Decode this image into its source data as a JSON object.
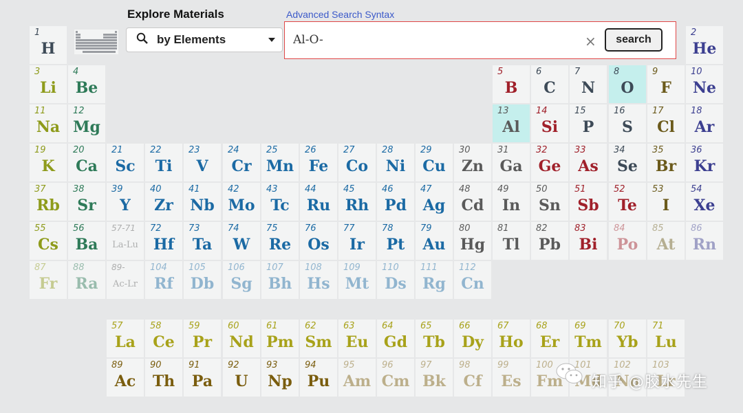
{
  "header": {
    "title": "Explore Materials",
    "advanced_link": "Advanced Search Syntax"
  },
  "search": {
    "mode_label": "by Elements",
    "value": "Al-O-",
    "clear_glyph": "×",
    "button_label": "search"
  },
  "watermark": {
    "text": "知乎 @胶水先生"
  },
  "elements": [
    {
      "n": "1",
      "s": "H",
      "row": 0,
      "col": 0,
      "c": "nonmetal"
    },
    {
      "n": "2",
      "s": "He",
      "row": 0,
      "col": 17,
      "c": "noble"
    },
    {
      "n": "3",
      "s": "Li",
      "row": 1,
      "col": 0,
      "c": "alkali"
    },
    {
      "n": "4",
      "s": "Be",
      "row": 1,
      "col": 1,
      "c": "alkaline"
    },
    {
      "n": "5",
      "s": "B",
      "row": 1,
      "col": 12,
      "c": "red"
    },
    {
      "n": "6",
      "s": "C",
      "row": 1,
      "col": 13,
      "c": "nonmetal"
    },
    {
      "n": "7",
      "s": "N",
      "row": 1,
      "col": 14,
      "c": "nonmetal"
    },
    {
      "n": "8",
      "s": "O",
      "row": 1,
      "col": 15,
      "c": "nonmetal",
      "hl": true
    },
    {
      "n": "9",
      "s": "F",
      "row": 1,
      "col": 16,
      "c": "halogen"
    },
    {
      "n": "10",
      "s": "Ne",
      "row": 1,
      "col": 17,
      "c": "noble"
    },
    {
      "n": "11",
      "s": "Na",
      "row": 2,
      "col": 0,
      "c": "alkali"
    },
    {
      "n": "12",
      "s": "Mg",
      "row": 2,
      "col": 1,
      "c": "alkaline"
    },
    {
      "n": "13",
      "s": "Al",
      "row": 2,
      "col": 12,
      "c": "post",
      "hl": true
    },
    {
      "n": "14",
      "s": "Si",
      "row": 2,
      "col": 13,
      "c": "red"
    },
    {
      "n": "15",
      "s": "P",
      "row": 2,
      "col": 14,
      "c": "nonmetal"
    },
    {
      "n": "16",
      "s": "S",
      "row": 2,
      "col": 15,
      "c": "nonmetal"
    },
    {
      "n": "17",
      "s": "Cl",
      "row": 2,
      "col": 16,
      "c": "halogen"
    },
    {
      "n": "18",
      "s": "Ar",
      "row": 2,
      "col": 17,
      "c": "noble"
    },
    {
      "n": "19",
      "s": "K",
      "row": 3,
      "col": 0,
      "c": "alkali"
    },
    {
      "n": "20",
      "s": "Ca",
      "row": 3,
      "col": 1,
      "c": "alkaline"
    },
    {
      "n": "21",
      "s": "Sc",
      "row": 3,
      "col": 2,
      "c": "tm"
    },
    {
      "n": "22",
      "s": "Ti",
      "row": 3,
      "col": 3,
      "c": "tm"
    },
    {
      "n": "23",
      "s": "V",
      "row": 3,
      "col": 4,
      "c": "tm"
    },
    {
      "n": "24",
      "s": "Cr",
      "row": 3,
      "col": 5,
      "c": "tm"
    },
    {
      "n": "25",
      "s": "Mn",
      "row": 3,
      "col": 6,
      "c": "tm"
    },
    {
      "n": "26",
      "s": "Fe",
      "row": 3,
      "col": 7,
      "c": "tm"
    },
    {
      "n": "27",
      "s": "Co",
      "row": 3,
      "col": 8,
      "c": "tm"
    },
    {
      "n": "28",
      "s": "Ni",
      "row": 3,
      "col": 9,
      "c": "tm"
    },
    {
      "n": "29",
      "s": "Cu",
      "row": 3,
      "col": 10,
      "c": "tm"
    },
    {
      "n": "30",
      "s": "Zn",
      "row": 3,
      "col": 11,
      "c": "post"
    },
    {
      "n": "31",
      "s": "Ga",
      "row": 3,
      "col": 12,
      "c": "post"
    },
    {
      "n": "32",
      "s": "Ge",
      "row": 3,
      "col": 13,
      "c": "red"
    },
    {
      "n": "33",
      "s": "As",
      "row": 3,
      "col": 14,
      "c": "red"
    },
    {
      "n": "34",
      "s": "Se",
      "row": 3,
      "col": 15,
      "c": "nonmetal"
    },
    {
      "n": "35",
      "s": "Br",
      "row": 3,
      "col": 16,
      "c": "halogen"
    },
    {
      "n": "36",
      "s": "Kr",
      "row": 3,
      "col": 17,
      "c": "noble"
    },
    {
      "n": "37",
      "s": "Rb",
      "row": 4,
      "col": 0,
      "c": "alkali"
    },
    {
      "n": "38",
      "s": "Sr",
      "row": 4,
      "col": 1,
      "c": "alkaline"
    },
    {
      "n": "39",
      "s": "Y",
      "row": 4,
      "col": 2,
      "c": "tm"
    },
    {
      "n": "40",
      "s": "Zr",
      "row": 4,
      "col": 3,
      "c": "tm"
    },
    {
      "n": "41",
      "s": "Nb",
      "row": 4,
      "col": 4,
      "c": "tm"
    },
    {
      "n": "42",
      "s": "Mo",
      "row": 4,
      "col": 5,
      "c": "tm"
    },
    {
      "n": "43",
      "s": "Tc",
      "row": 4,
      "col": 6,
      "c": "tm"
    },
    {
      "n": "44",
      "s": "Ru",
      "row": 4,
      "col": 7,
      "c": "tm"
    },
    {
      "n": "45",
      "s": "Rh",
      "row": 4,
      "col": 8,
      "c": "tm"
    },
    {
      "n": "46",
      "s": "Pd",
      "row": 4,
      "col": 9,
      "c": "tm"
    },
    {
      "n": "47",
      "s": "Ag",
      "row": 4,
      "col": 10,
      "c": "tm"
    },
    {
      "n": "48",
      "s": "Cd",
      "row": 4,
      "col": 11,
      "c": "post"
    },
    {
      "n": "49",
      "s": "In",
      "row": 4,
      "col": 12,
      "c": "post"
    },
    {
      "n": "50",
      "s": "Sn",
      "row": 4,
      "col": 13,
      "c": "post"
    },
    {
      "n": "51",
      "s": "Sb",
      "row": 4,
      "col": 14,
      "c": "red"
    },
    {
      "n": "52",
      "s": "Te",
      "row": 4,
      "col": 15,
      "c": "red"
    },
    {
      "n": "53",
      "s": "I",
      "row": 4,
      "col": 16,
      "c": "halogen"
    },
    {
      "n": "54",
      "s": "Xe",
      "row": 4,
      "col": 17,
      "c": "noble"
    },
    {
      "n": "55",
      "s": "Cs",
      "row": 5,
      "col": 0,
      "c": "alkali"
    },
    {
      "n": "56",
      "s": "Ba",
      "row": 5,
      "col": 1,
      "c": "alkaline"
    },
    {
      "n": "57-71",
      "s": "La-Lu",
      "row": 5,
      "col": 2,
      "c": "post",
      "range": true,
      "faded": true
    },
    {
      "n": "72",
      "s": "Hf",
      "row": 5,
      "col": 3,
      "c": "tm"
    },
    {
      "n": "73",
      "s": "Ta",
      "row": 5,
      "col": 4,
      "c": "tm"
    },
    {
      "n": "74",
      "s": "W",
      "row": 5,
      "col": 5,
      "c": "tm"
    },
    {
      "n": "75",
      "s": "Re",
      "row": 5,
      "col": 6,
      "c": "tm"
    },
    {
      "n": "76",
      "s": "Os",
      "row": 5,
      "col": 7,
      "c": "tm"
    },
    {
      "n": "77",
      "s": "Ir",
      "row": 5,
      "col": 8,
      "c": "tm"
    },
    {
      "n": "78",
      "s": "Pt",
      "row": 5,
      "col": 9,
      "c": "tm"
    },
    {
      "n": "79",
      "s": "Au",
      "row": 5,
      "col": 10,
      "c": "tm"
    },
    {
      "n": "80",
      "s": "Hg",
      "row": 5,
      "col": 11,
      "c": "post"
    },
    {
      "n": "81",
      "s": "Tl",
      "row": 5,
      "col": 12,
      "c": "post"
    },
    {
      "n": "82",
      "s": "Pb",
      "row": 5,
      "col": 13,
      "c": "post"
    },
    {
      "n": "83",
      "s": "Bi",
      "row": 5,
      "col": 14,
      "c": "red"
    },
    {
      "n": "84",
      "s": "Po",
      "row": 5,
      "col": 15,
      "c": "red",
      "faded": true
    },
    {
      "n": "85",
      "s": "At",
      "row": 5,
      "col": 16,
      "c": "halogen",
      "faded": true
    },
    {
      "n": "86",
      "s": "Rn",
      "row": 5,
      "col": 17,
      "c": "noble",
      "faded": true
    },
    {
      "n": "87",
      "s": "Fr",
      "row": 6,
      "col": 0,
      "c": "alkali",
      "faded": true
    },
    {
      "n": "88",
      "s": "Ra",
      "row": 6,
      "col": 1,
      "c": "alkaline",
      "faded": true
    },
    {
      "n": "89-",
      "s": "Ac-Lr",
      "row": 6,
      "col": 2,
      "c": "post",
      "range": true,
      "faded": true
    },
    {
      "n": "104",
      "s": "Rf",
      "row": 6,
      "col": 3,
      "c": "tm",
      "faded": true
    },
    {
      "n": "105",
      "s": "Db",
      "row": 6,
      "col": 4,
      "c": "tm",
      "faded": true
    },
    {
      "n": "106",
      "s": "Sg",
      "row": 6,
      "col": 5,
      "c": "tm",
      "faded": true
    },
    {
      "n": "107",
      "s": "Bh",
      "row": 6,
      "col": 6,
      "c": "tm",
      "faded": true
    },
    {
      "n": "108",
      "s": "Hs",
      "row": 6,
      "col": 7,
      "c": "tm",
      "faded": true
    },
    {
      "n": "109",
      "s": "Mt",
      "row": 6,
      "col": 8,
      "c": "tm",
      "faded": true
    },
    {
      "n": "110",
      "s": "Ds",
      "row": 6,
      "col": 9,
      "c": "tm",
      "faded": true
    },
    {
      "n": "111",
      "s": "Rg",
      "row": 6,
      "col": 10,
      "c": "tm",
      "faded": true
    },
    {
      "n": "112",
      "s": "Cn",
      "row": 6,
      "col": 11,
      "c": "tm",
      "faded": true
    },
    {
      "n": "57",
      "s": "La",
      "row": 7,
      "col": 2,
      "c": "lan"
    },
    {
      "n": "58",
      "s": "Ce",
      "row": 7,
      "col": 3,
      "c": "lan"
    },
    {
      "n": "59",
      "s": "Pr",
      "row": 7,
      "col": 4,
      "c": "lan"
    },
    {
      "n": "60",
      "s": "Nd",
      "row": 7,
      "col": 5,
      "c": "lan"
    },
    {
      "n": "61",
      "s": "Pm",
      "row": 7,
      "col": 6,
      "c": "lan"
    },
    {
      "n": "62",
      "s": "Sm",
      "row": 7,
      "col": 7,
      "c": "lan"
    },
    {
      "n": "63",
      "s": "Eu",
      "row": 7,
      "col": 8,
      "c": "lan"
    },
    {
      "n": "64",
      "s": "Gd",
      "row": 7,
      "col": 9,
      "c": "lan"
    },
    {
      "n": "65",
      "s": "Tb",
      "row": 7,
      "col": 10,
      "c": "lan"
    },
    {
      "n": "66",
      "s": "Dy",
      "row": 7,
      "col": 11,
      "c": "lan"
    },
    {
      "n": "67",
      "s": "Ho",
      "row": 7,
      "col": 12,
      "c": "lan"
    },
    {
      "n": "68",
      "s": "Er",
      "row": 7,
      "col": 13,
      "c": "lan"
    },
    {
      "n": "69",
      "s": "Tm",
      "row": 7,
      "col": 14,
      "c": "lan"
    },
    {
      "n": "70",
      "s": "Yb",
      "row": 7,
      "col": 15,
      "c": "lan"
    },
    {
      "n": "71",
      "s": "Lu",
      "row": 7,
      "col": 16,
      "c": "lan"
    },
    {
      "n": "89",
      "s": "Ac",
      "row": 8,
      "col": 2,
      "c": "act"
    },
    {
      "n": "90",
      "s": "Th",
      "row": 8,
      "col": 3,
      "c": "act"
    },
    {
      "n": "91",
      "s": "Pa",
      "row": 8,
      "col": 4,
      "c": "act"
    },
    {
      "n": "92",
      "s": "U",
      "row": 8,
      "col": 5,
      "c": "act"
    },
    {
      "n": "93",
      "s": "Np",
      "row": 8,
      "col": 6,
      "c": "act"
    },
    {
      "n": "94",
      "s": "Pu",
      "row": 8,
      "col": 7,
      "c": "act"
    },
    {
      "n": "95",
      "s": "Am",
      "row": 8,
      "col": 8,
      "c": "act",
      "faded": true
    },
    {
      "n": "96",
      "s": "Cm",
      "row": 8,
      "col": 9,
      "c": "act",
      "faded": true
    },
    {
      "n": "97",
      "s": "Bk",
      "row": 8,
      "col": 10,
      "c": "act",
      "faded": true
    },
    {
      "n": "98",
      "s": "Cf",
      "row": 8,
      "col": 11,
      "c": "act",
      "faded": true
    },
    {
      "n": "99",
      "s": "Es",
      "row": 8,
      "col": 12,
      "c": "act",
      "faded": true
    },
    {
      "n": "100",
      "s": "Fm",
      "row": 8,
      "col": 13,
      "c": "act",
      "faded": true
    },
    {
      "n": "101",
      "s": "Md",
      "row": 8,
      "col": 14,
      "c": "act",
      "faded": true
    },
    {
      "n": "102",
      "s": "No",
      "row": 8,
      "col": 15,
      "c": "act",
      "faded": true
    },
    {
      "n": "103",
      "s": "Lr",
      "row": 8,
      "col": 16,
      "c": "act",
      "faded": true
    }
  ]
}
